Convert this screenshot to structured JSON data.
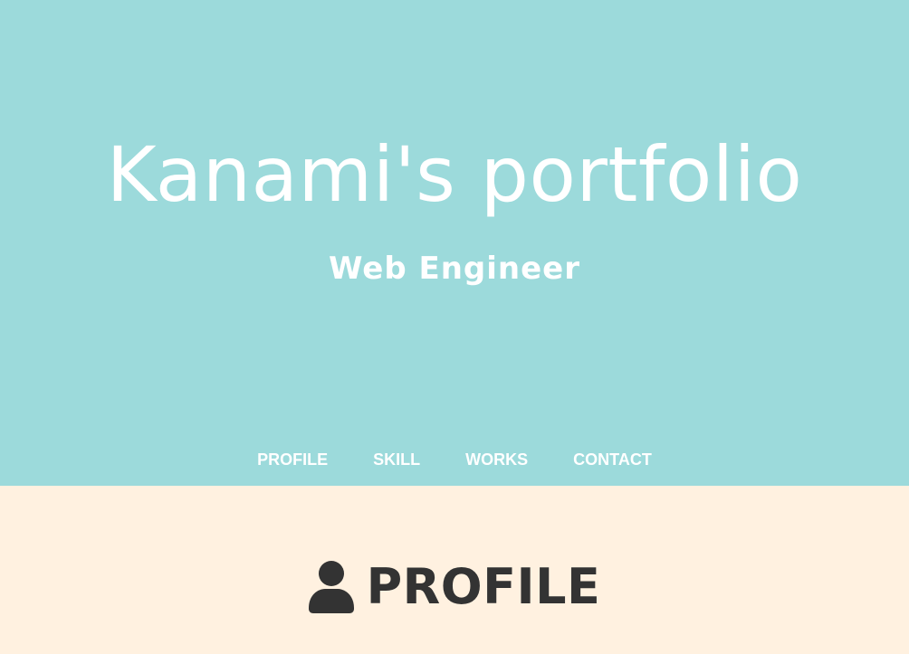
{
  "hero": {
    "title": "Kanami's portfolio",
    "subtitle": "Web Engineer",
    "background_color": "#9cdadb",
    "text_color": "#ffffff"
  },
  "nav": {
    "items": [
      {
        "label": "PROFILE"
      },
      {
        "label": "SKILL"
      },
      {
        "label": "WORKS"
      },
      {
        "label": "CONTACT"
      }
    ]
  },
  "profile_section": {
    "icon": "user-icon",
    "title": "PROFILE",
    "background_color": "#fff1e0",
    "text_color": "#333333"
  }
}
